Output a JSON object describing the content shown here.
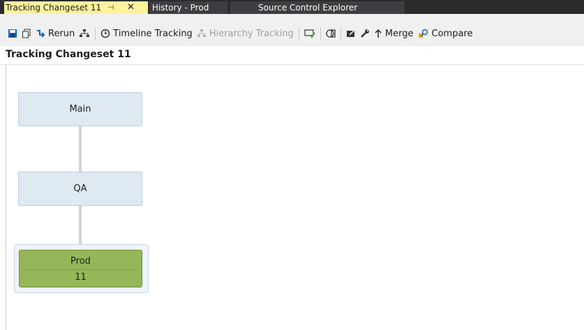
{
  "tabs": {
    "active": {
      "label": "Tracking Changeset 11",
      "pin": "⊣",
      "close": "✕"
    },
    "history": {
      "label": "History - Prod"
    },
    "explorer": {
      "label": "Source Control Explorer"
    }
  },
  "toolbar": {
    "save_icon": "floppy-icon",
    "copy_icon": "copy-icon",
    "rerun_label": "Rerun",
    "timeline_label": "Timeline Tracking",
    "hierarchy_label": "Hierarchy Tracking",
    "merge_label": "Merge",
    "compare_label": "Compare"
  },
  "page": {
    "title": "Tracking Changeset 11"
  },
  "nodes": {
    "main": {
      "label": "Main"
    },
    "qa": {
      "label": "QA"
    },
    "prod": {
      "label": "Prod",
      "changeset": "11"
    }
  },
  "colors": {
    "tab_active": "#fff29d",
    "node_fill": "#dfe9f2",
    "prod_fill": "#95b659",
    "toolbar_icon_blue": "#1c5fb5"
  }
}
